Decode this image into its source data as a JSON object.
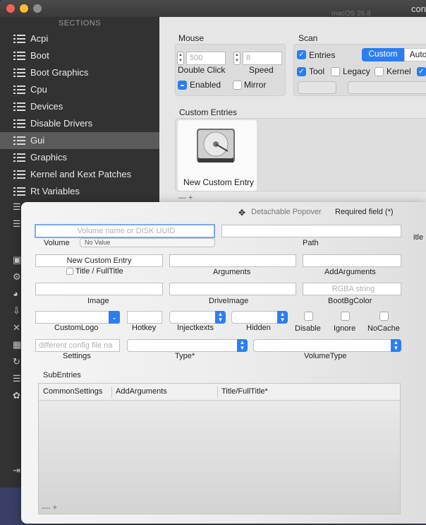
{
  "window": {
    "title": "con",
    "ghost_title": "macOS 26.8"
  },
  "sidebar": {
    "header": "SECTIONS",
    "items": [
      {
        "label": "Acpi"
      },
      {
        "label": "Boot"
      },
      {
        "label": "Boot Graphics"
      },
      {
        "label": "Cpu"
      },
      {
        "label": "Devices"
      },
      {
        "label": "Disable Drivers"
      },
      {
        "label": "Gui",
        "selected": true
      },
      {
        "label": "Graphics"
      },
      {
        "label": "Kernel and Kext Patches"
      },
      {
        "label": "Rt Variables"
      }
    ]
  },
  "mouse": {
    "title": "Mouse",
    "double_click_placeholder": "500",
    "speed_placeholder": "8",
    "double_click_label": "Double Click",
    "speed_label": "Speed",
    "enabled_label": "Enabled",
    "mirror_label": "Mirror"
  },
  "scan": {
    "title": "Scan",
    "entries_label": "Entries",
    "custom_label": "Custom",
    "auto_label": "Auto",
    "tool_label": "Tool",
    "legacy_label": "Legacy",
    "kernel_label": "Kernel"
  },
  "custom_entries": {
    "title": "Custom Entries",
    "entry_label": "New Custom Entry",
    "controls": "— +"
  },
  "popover": {
    "detachable_label": "Detachable Popover",
    "required_label": "Required field (*)",
    "volume_placeholder": "Volume name or DISK UUID",
    "volume_label": "Volume",
    "volume_popup_value": "No Value",
    "path_label": "Path",
    "title_value": "New Custom Entry",
    "title_check_label": "Title / FullTitle",
    "arguments_label": "Arguments",
    "add_arguments_label": "AddArguments",
    "image_label": "Image",
    "drive_image_label": "DriveImage",
    "bootbgcolor_placeholder": "RGBA string",
    "bootbgcolor_label": "BootBgColor",
    "custom_logo_label": "CustomLogo",
    "hotkey_label": "Hotkey",
    "injectkexts_label": "Injectkexts",
    "hidden_label": "Hidden",
    "disable_label": "Disable",
    "ignore_label": "Ignore",
    "nocache_label": "NoCache",
    "settings_placeholder": "different config file na",
    "settings_label": "Settings",
    "type_label": "Type*",
    "volume_type_label": "VolumeType",
    "subentries_title": "SubEntries",
    "columns": [
      "CommonSettings",
      "AddArguments",
      "Title/FullTitle*"
    ],
    "table_controls": "— +",
    "right_edge_label": "itle"
  },
  "colors": {
    "accent": "#2b7ef2",
    "sidebar_bg": "#323232",
    "sidebar_selected": "#5a5a5a"
  }
}
